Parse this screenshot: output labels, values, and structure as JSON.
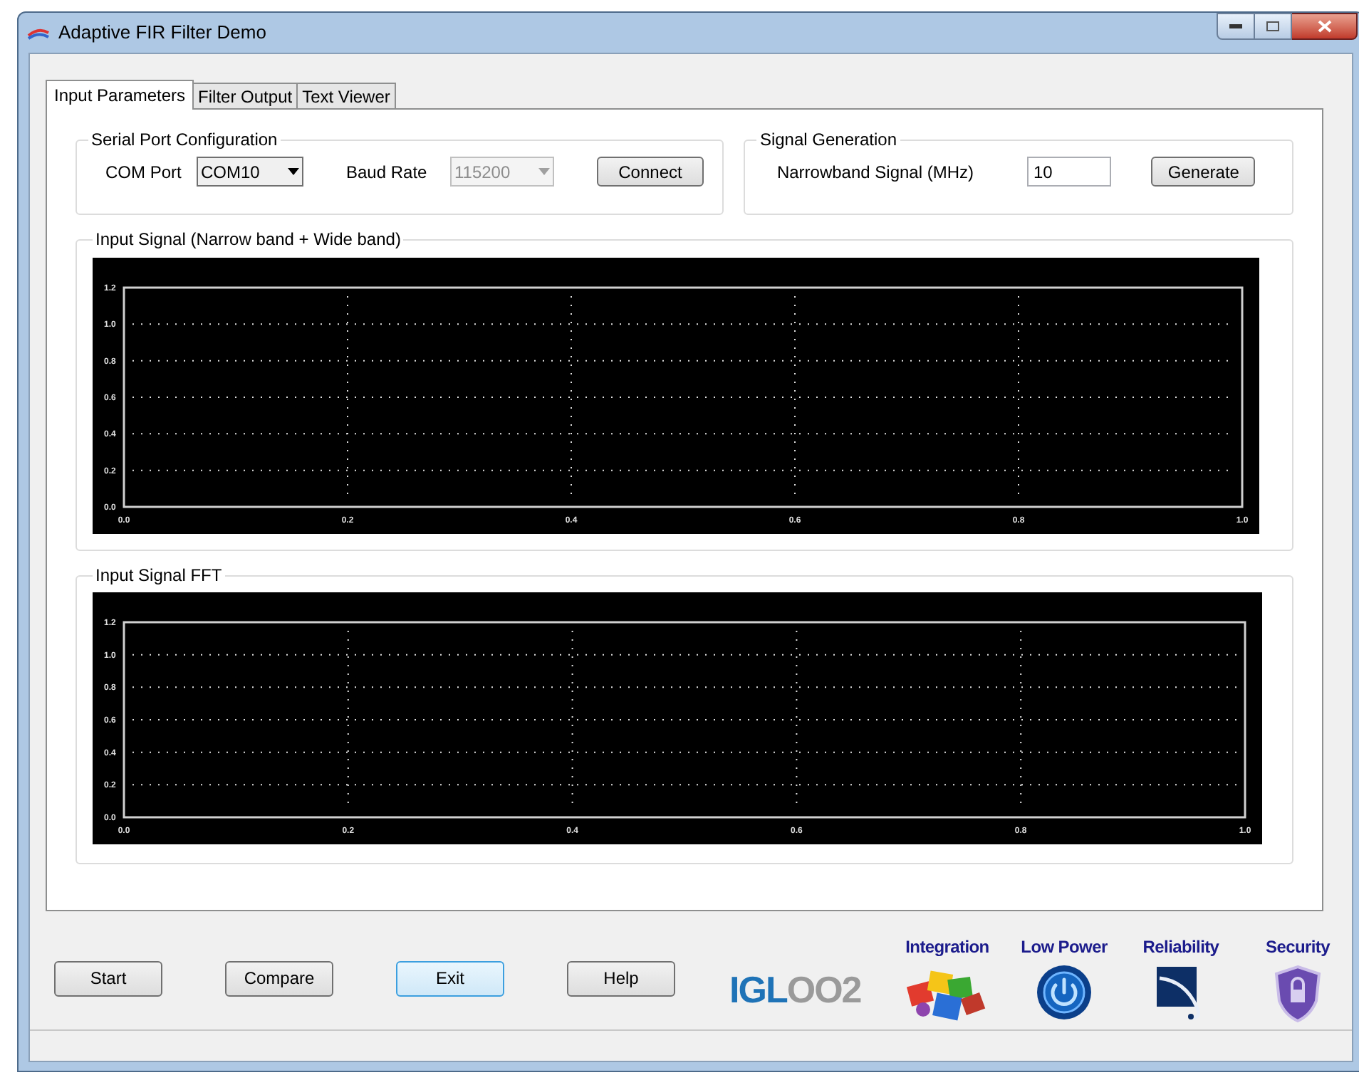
{
  "window": {
    "title": "Adaptive FIR Filter Demo"
  },
  "tabs": [
    {
      "label": "Input Parameters",
      "selected": true
    },
    {
      "label": "Filter Output",
      "selected": false
    },
    {
      "label": "Text Viewer",
      "selected": false
    }
  ],
  "serial_port": {
    "title": "Serial Port Configuration",
    "com_port": {
      "label": "COM Port",
      "value": "COM10"
    },
    "baud_rate": {
      "label": "Baud Rate",
      "value": "115200",
      "disabled": true
    },
    "connect_button": "Connect"
  },
  "signal_generation": {
    "title": "Signal Generation",
    "label": "Narrowband Signal (MHz)",
    "value": "10",
    "button": "Generate"
  },
  "charts": [
    {
      "title": "Input Signal (Narrow band + Wide band)",
      "chart_data": {
        "type": "line",
        "grid": true,
        "xlim": [
          0,
          1
        ],
        "ylim": [
          0,
          1.2
        ],
        "xticks": [
          {
            "value": 0,
            "label": "0.0"
          },
          {
            "value": 0.2,
            "label": "0.2"
          },
          {
            "value": 0.4,
            "label": "0.4"
          },
          {
            "value": 0.6,
            "label": "0.6"
          },
          {
            "value": 0.8,
            "label": "0.8"
          },
          {
            "value": 1,
            "label": "1.0"
          }
        ],
        "yticks": [
          {
            "value": 0,
            "label": "0.0"
          },
          {
            "value": 0.2,
            "label": "0.2"
          },
          {
            "value": 0.4,
            "label": "0.4"
          },
          {
            "value": 0.6,
            "label": "0.6"
          },
          {
            "value": 0.8,
            "label": "0.8"
          },
          {
            "value": 1,
            "label": "1.0"
          },
          {
            "value": 1.2,
            "label": "1.2"
          }
        ]
      }
    },
    {
      "title": "Input Signal FFT",
      "chart_data": {
        "type": "line",
        "grid": true,
        "xlim": [
          0,
          1
        ],
        "ylim": [
          0,
          1.2
        ],
        "xticks": [
          {
            "value": 0,
            "label": "0.0"
          },
          {
            "value": 0.2,
            "label": "0.2"
          },
          {
            "value": 0.4,
            "label": "0.4"
          },
          {
            "value": 0.6,
            "label": "0.6"
          },
          {
            "value": 0.8,
            "label": "0.8"
          },
          {
            "value": 1,
            "label": "1.0"
          }
        ],
        "yticks": [
          {
            "value": 0,
            "label": "0.0"
          },
          {
            "value": 0.2,
            "label": "0.2"
          },
          {
            "value": 0.4,
            "label": "0.4"
          },
          {
            "value": 0.6,
            "label": "0.6"
          },
          {
            "value": 0.8,
            "label": "0.8"
          },
          {
            "value": 1,
            "label": "1.0"
          },
          {
            "value": 1.2,
            "label": "1.2"
          }
        ]
      }
    }
  ],
  "buttons": [
    {
      "label": "Start",
      "focused": false
    },
    {
      "label": "Compare",
      "focused": false
    },
    {
      "label": "Exit",
      "focused": true
    },
    {
      "label": "Help",
      "focused": false
    }
  ],
  "logo": {
    "text": "IGLOO2"
  },
  "features": [
    {
      "label": "Integration",
      "kind": "puzzle"
    },
    {
      "label": "Low Power",
      "kind": "power"
    },
    {
      "label": "Reliability",
      "kind": "reliability"
    },
    {
      "label": "Security",
      "kind": "shield"
    }
  ]
}
